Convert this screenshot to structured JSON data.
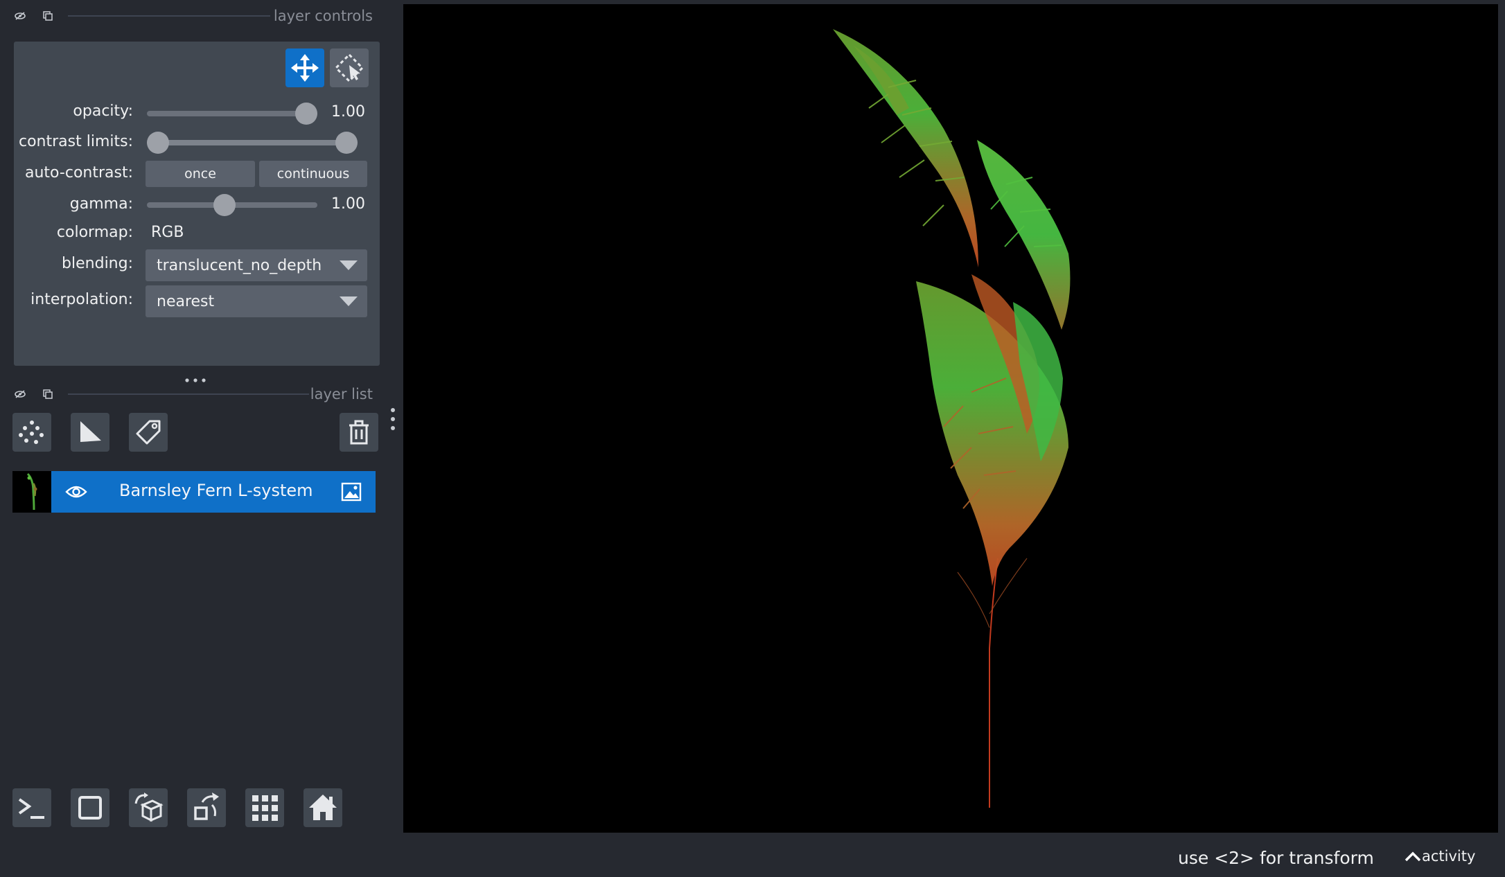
{
  "layer_controls": {
    "title": "layer controls",
    "opacity": {
      "label": "opacity:",
      "value": "1.00",
      "level": 1.0
    },
    "contrast_limits": {
      "label": "contrast limits:",
      "low": 0.0,
      "high": 1.0
    },
    "auto_contrast": {
      "label": "auto-contrast:",
      "once": "once",
      "continuous": "continuous"
    },
    "gamma": {
      "label": "gamma:",
      "value": "1.00",
      "level": 0.45
    },
    "colormap": {
      "label": "colormap:",
      "value": "RGB"
    },
    "blending": {
      "label": "blending:",
      "value": "translucent_no_depth"
    },
    "interpolation": {
      "label": "interpolation:",
      "value": "nearest"
    }
  },
  "layer_list": {
    "title": "layer list",
    "layers": [
      {
        "name": "Barnsley Fern L-system",
        "visible": true,
        "selected": true
      }
    ]
  },
  "status": {
    "message": "use <2> for transform",
    "activity": "activity"
  },
  "colors": {
    "accent": "#0f70c8",
    "background": "#262930",
    "panel": "#414851",
    "canvas": "#000000"
  },
  "icons": {
    "layer_controls_bar": [
      "eye-slash-icon",
      "float-window-icon"
    ],
    "modes": [
      "move-icon",
      "transform-select-icon"
    ],
    "layer_tools": [
      "new-points-icon",
      "new-shapes-icon",
      "new-labels-icon",
      "delete-layer-icon"
    ],
    "bottom": [
      "console-icon",
      "ndisplay-icon",
      "roll-dims-icon",
      "transpose-icon",
      "grid-icon",
      "home-icon"
    ]
  }
}
